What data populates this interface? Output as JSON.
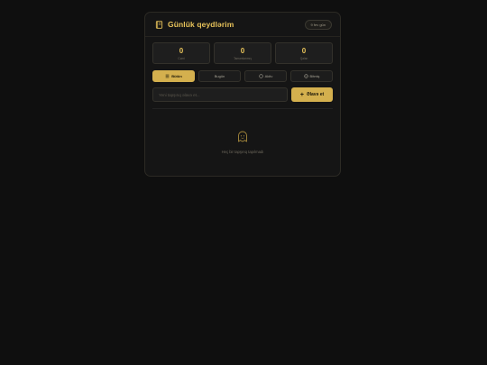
{
  "header": {
    "title": "Günlük qeydlərim",
    "date": "9 fev gün",
    "icon": "book-icon",
    "accent": "#e8c35a"
  },
  "stats": [
    {
      "value": "0",
      "label": "Cəmi"
    },
    {
      "value": "0",
      "label": "Tamamlanmış"
    },
    {
      "value": "0",
      "label": "Qalan"
    }
  ],
  "tabs": [
    {
      "label": "Bütün",
      "icon": "list-icon",
      "active": true
    },
    {
      "label": "Bugün",
      "icon": "none",
      "active": false
    },
    {
      "label": "Aktiv",
      "icon": "circle-icon",
      "active": false
    },
    {
      "label": "Bitmiş",
      "icon": "check-circle-icon",
      "active": false
    }
  ],
  "add": {
    "placeholder": "Yeni tapşırıq əlavə et...",
    "button_label": "Əlavə et",
    "button_icon": "plus-icon"
  },
  "empty": {
    "icon": "ghost-icon",
    "text": "Heç bir tapşırıq tapılmadı"
  }
}
